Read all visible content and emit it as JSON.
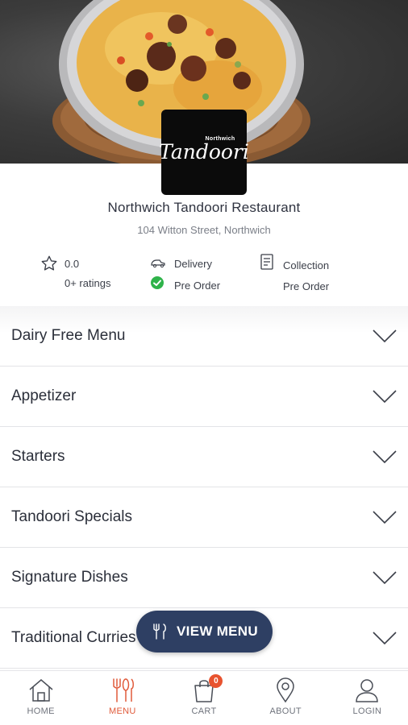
{
  "restaurant": {
    "logo_small": "Northwich",
    "logo_script": "Tandoori",
    "name": "Northwich Tandoori Restaurant",
    "address": "104 Witton Street, Northwich"
  },
  "info": {
    "rating": "0.0",
    "ratings_count": "0+ ratings",
    "delivery_label": "Delivery",
    "delivery_preorder": "Pre Order",
    "collection_label": "Collection",
    "collection_preorder": "Pre Order"
  },
  "menu_categories": [
    "Dairy Free Menu",
    "Appetizer",
    "Starters",
    "Tandoori Specials",
    "Signature Dishes",
    "Traditional Curries"
  ],
  "view_menu_button": "VIEW MENU",
  "bottom_nav": {
    "home": "HOME",
    "menu": "MENU",
    "cart": "CART",
    "cart_count": "0",
    "about": "ABOUT",
    "login": "LOGIN"
  },
  "colors": {
    "accent": "#e05a3a",
    "button": "#2e3f63",
    "check": "#2fb34a"
  }
}
